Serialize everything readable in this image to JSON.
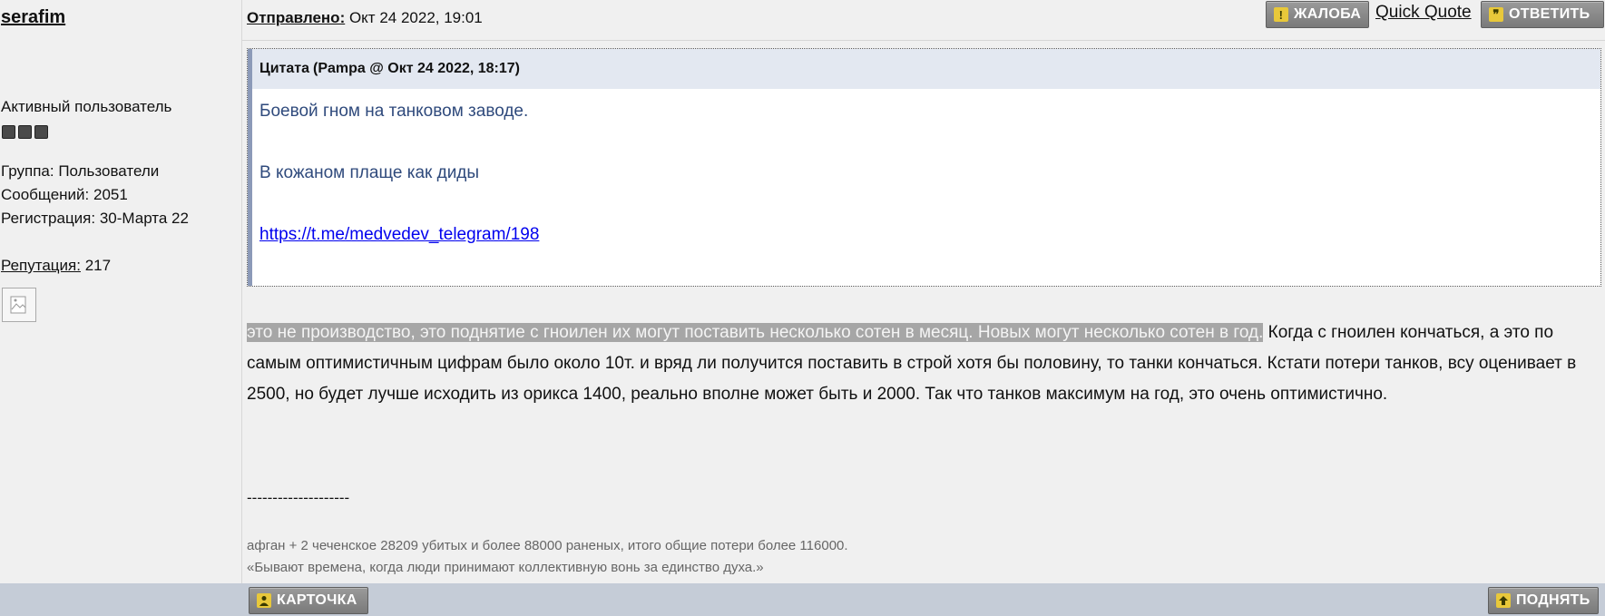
{
  "user": {
    "name": "serafim",
    "rank": "Активный пользователь",
    "group": "Группа: Пользователи",
    "posts": "Сообщений: 2051",
    "registered": "Регистрация: 30-Марта 22",
    "reputation_label": "Репутация:",
    "reputation_value": " 217"
  },
  "header": {
    "sent_label": "Отправлено:",
    "sent_value": " Окт 24 2022, 19:01",
    "report_label": "ЖАЛОБА",
    "quick_quote_label": "Quick Quote",
    "reply_label": "ОТВЕТИТЬ"
  },
  "quote": {
    "title": "Цитата",
    "meta": "(Pampa @ Окт 24 2022, 18:17)",
    "line1": "Боевой гном на танковом заводе.",
    "line2": "В кожаном плаще как диды",
    "link": "https://t.me/medvedev_telegram/198"
  },
  "post": {
    "highlighted": "это не производство, это поднятие с гноилен их могут поставить несколько сотен в месяц. Новых могут несколько сотен в год.",
    "rest": " Когда с гноилен кончаться, а это по самым оптимистичным цифрам было около 10т. и вряд ли получится поставить в строй хотя бы половину, то танки кончаться. Кстати потери танков, всу оценивает в 2500, но будет лучше исходить из орикса 1400, реально вполне может быть и 2000. Так что танков максимум на год, это очень оптимистично."
  },
  "signature": {
    "separator": "--------------------",
    "line1": "афган + 2 чеченское 28209 убитых и более 88000 раненых, итого общие потери более 116000.",
    "line2": "«Бывают времена, когда люди принимают коллективную вонь за единство духа.»"
  },
  "footer": {
    "card_label": "КАРТОЧКА",
    "up_label": "ПОДНЯТЬ"
  },
  "icons": {
    "report": "exclamation-icon",
    "reply": "quote-marks-icon",
    "card": "user-icon",
    "up": "arrow-up-icon",
    "reputation": "broken-image-icon"
  },
  "colors": {
    "quote_text": "#2f4a7c",
    "quote_bar": "#8c9ab8",
    "footer_bg": "#c5ccd7",
    "button_bg": "#8a8a8a",
    "highlight_bg": "#a6a6a6"
  }
}
